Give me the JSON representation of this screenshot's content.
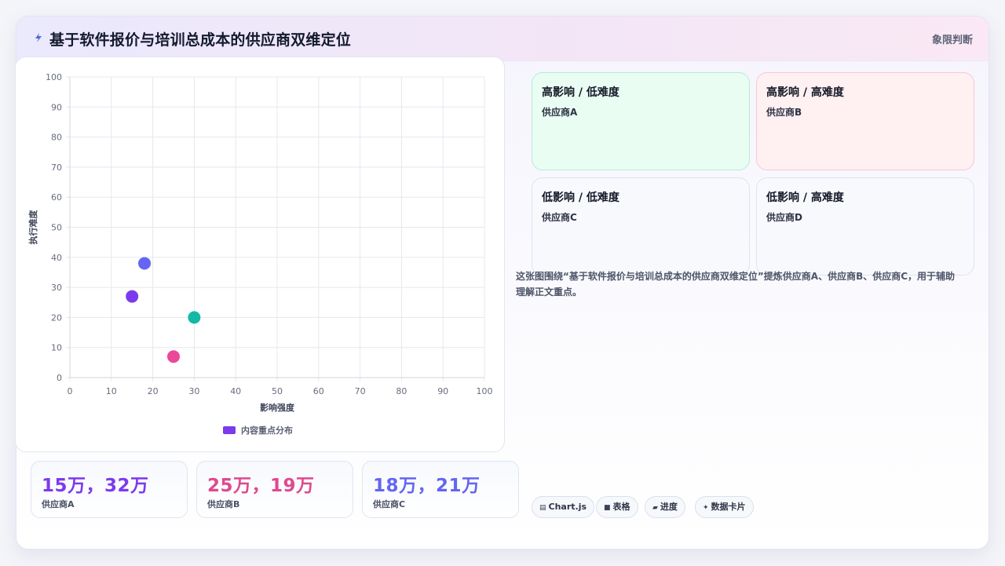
{
  "header": {
    "title": "基于软件报价与培训总成本的供应商双维定位",
    "action_label": "象限判断"
  },
  "chart_data": {
    "type": "scatter",
    "xlabel": "影响强度",
    "ylabel": "执行难度",
    "xlim": [
      0,
      100
    ],
    "ylim": [
      0,
      100
    ],
    "xticks": [
      0,
      10,
      20,
      30,
      40,
      50,
      60,
      70,
      80,
      90,
      100
    ],
    "yticks": [
      0,
      10,
      20,
      30,
      40,
      50,
      60,
      70,
      80,
      90,
      100
    ],
    "grid": true,
    "legend_position": "bottom",
    "legend": "内容重点分布",
    "points": [
      {
        "x": 15,
        "y": 27,
        "color": "#7c3aed"
      },
      {
        "x": 18,
        "y": 38,
        "color": "#6366f1"
      },
      {
        "x": 25,
        "y": 7,
        "color": "#ec4899"
      },
      {
        "x": 30,
        "y": 20,
        "color": "#14b8a6"
      }
    ]
  },
  "stats": [
    {
      "value": "15万，32万",
      "label": "供应商A",
      "color": "#7c3aed"
    },
    {
      "value": "25万，19万",
      "label": "供应商B",
      "color": "#e0488f"
    },
    {
      "value": "18万，21万",
      "label": "供应商C",
      "color": "#6366f1"
    }
  ],
  "quadrants": [
    {
      "title": "高影响 / 低难度",
      "item": "供应商A",
      "bg": "#eafdf3",
      "border": "#b6ecd0"
    },
    {
      "title": "高影响 / 高难度",
      "item": "供应商B",
      "bg": "#fff0f2",
      "border": "#f5c8d2"
    },
    {
      "title": "低影响 / 低难度",
      "item": "供应商C",
      "bg": "#f8f9fd",
      "border": "#dfe4ee"
    },
    {
      "title": "低影响 / 高难度",
      "item": "供应商D",
      "bg": "#f8f9fd",
      "border": "#dfe4ee"
    }
  ],
  "description": "这张图围绕“基于软件报价与培训总成本的供应商双维定位”提炼供应商A、供应商B、供应商C，用于辅助理解正文重点。",
  "tags": [
    {
      "icon": "chart-icon",
      "glyph": "▤",
      "label": "Chart.js"
    },
    {
      "icon": "table-icon",
      "glyph": "■",
      "label": "表格"
    },
    {
      "icon": "progress-icon",
      "glyph": "▰",
      "label": "进度"
    },
    {
      "icon": "card-icon",
      "glyph": "✦",
      "label": "数据卡片"
    }
  ]
}
